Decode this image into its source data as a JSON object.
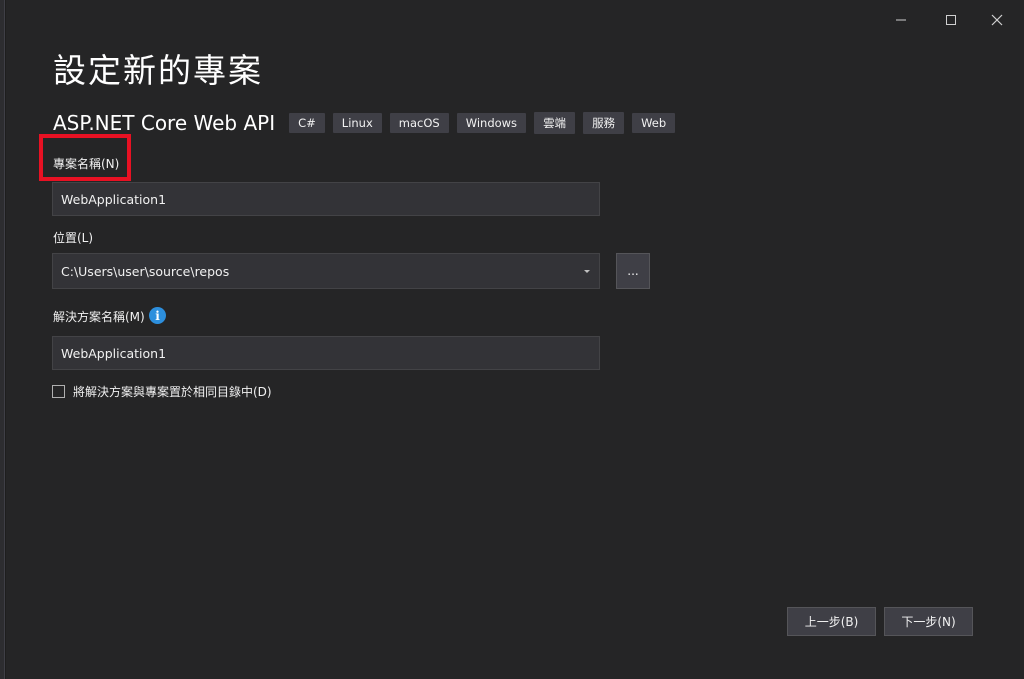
{
  "dialog": {
    "title": "設定新的專案",
    "window_controls": {
      "minimize": "minimize-icon",
      "maximize": "maximize-icon",
      "close": "close-icon"
    }
  },
  "template": {
    "name": "ASP.NET Core Web API",
    "tags": [
      "C#",
      "Linux",
      "macOS",
      "Windows",
      "雲端",
      "服務",
      "Web"
    ]
  },
  "form": {
    "project_name": {
      "label": "專案名稱(N)",
      "value": "WebApplication1"
    },
    "location": {
      "label": "位置(L)",
      "value": "C:\\Users\\user\\source\\repos",
      "browse_label": "..."
    },
    "solution_name": {
      "label": "解決方案名稱(M)",
      "value": "WebApplication1",
      "info_icon": "i"
    },
    "same_directory": {
      "label": "將解決方案與專案置於相同目錄中(D)",
      "checked": false
    }
  },
  "footer": {
    "back_label": "上一步(B)",
    "next_label": "下一步(N)"
  },
  "colors": {
    "background": "#252526",
    "input_bg": "#333337",
    "highlight": "#e81123",
    "info_blue": "#2d8fdd"
  }
}
